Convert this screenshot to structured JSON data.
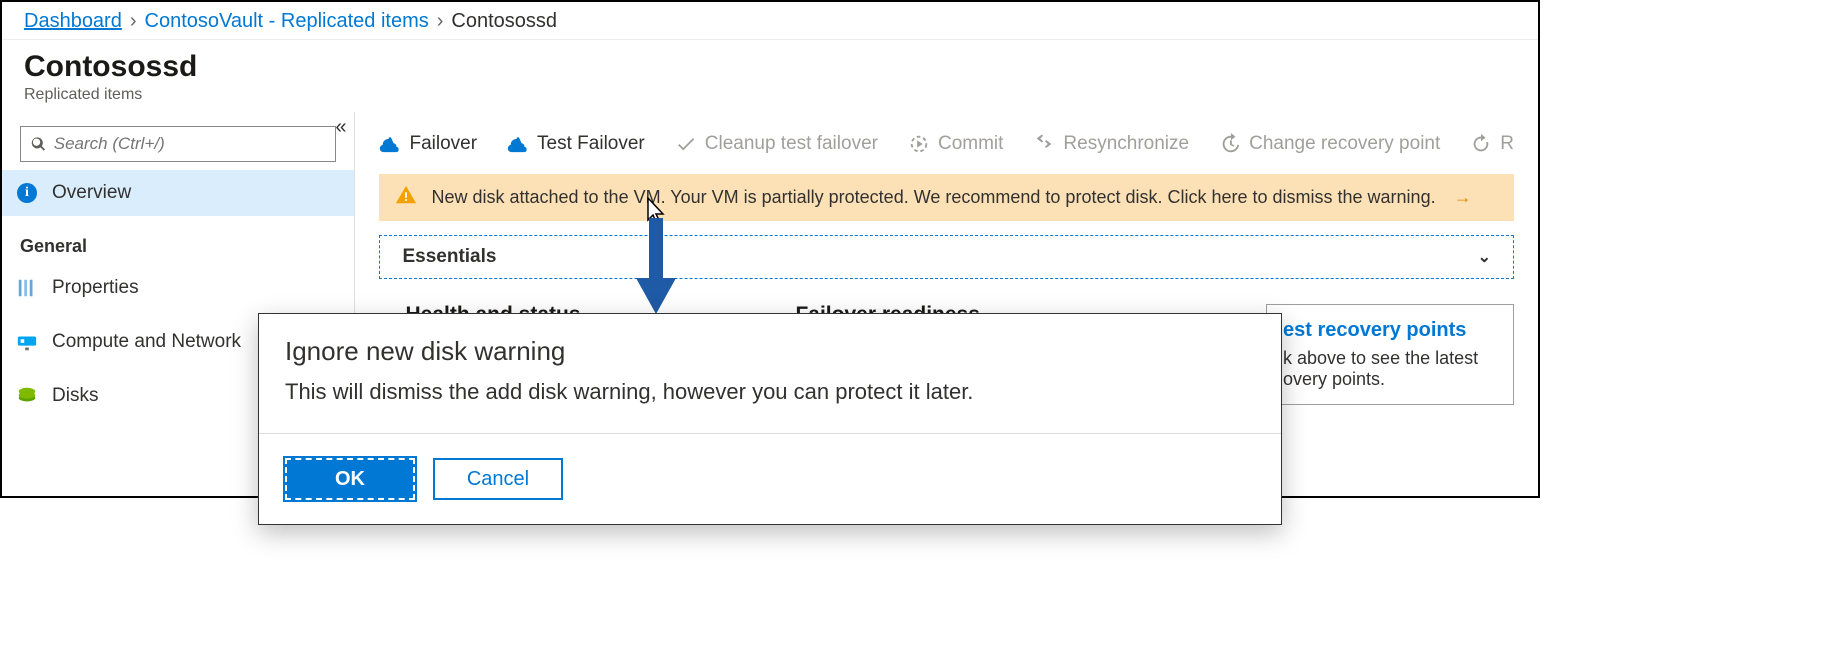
{
  "breadcrumb": {
    "items": [
      {
        "label": "Dashboard",
        "link": true
      },
      {
        "label": "ContosoVault - Replicated items",
        "link": true
      },
      {
        "label": "Contosossd",
        "link": false
      }
    ]
  },
  "header": {
    "title": "Contosossd",
    "subtitle": "Replicated items"
  },
  "sidebar": {
    "search_placeholder": "Search (Ctrl+/)",
    "overview_label": "Overview",
    "section_general": "General",
    "properties_label": "Properties",
    "compute_label": "Compute and Network",
    "disks_label": "Disks"
  },
  "toolbar": {
    "failover": "Failover",
    "test_failover": "Test Failover",
    "cleanup": "Cleanup test failover",
    "commit": "Commit",
    "resync": "Resynchronize",
    "change_rp": "Change recovery point",
    "more": "R"
  },
  "warning": {
    "text": "New disk attached to the VM. Your VM is partially protected. We recommend to protect disk. Click here to dismiss the warning."
  },
  "essentials": {
    "label": "Essentials"
  },
  "sections": {
    "health": "Health and status",
    "failover_readiness": "Failover readiness"
  },
  "recovery_card": {
    "title": "est recovery points",
    "body": "k above to see the latest overy points."
  },
  "modal": {
    "title": "Ignore new disk warning",
    "body": "This will dismiss the add disk warning, however you can protect it later.",
    "ok": "OK",
    "cancel": "Cancel"
  }
}
